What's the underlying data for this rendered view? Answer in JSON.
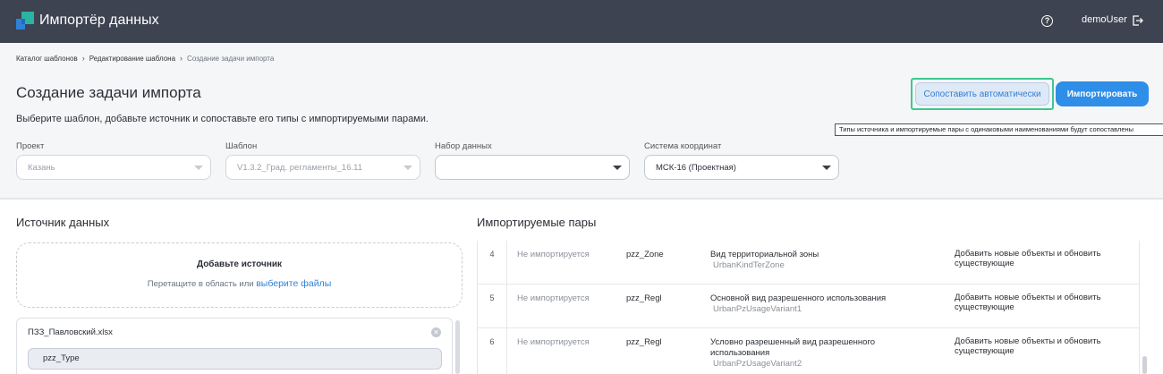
{
  "header": {
    "app_title": "Импортёр данных",
    "username": "demoUser",
    "help_icon_text": "?"
  },
  "breadcrumb": {
    "items": [
      "Каталог шаблонов",
      "Редактирование шаблона",
      "Создание задачи импорта"
    ],
    "separator": "›"
  },
  "page": {
    "title": "Создание задачи импорта",
    "subtitle": "Выберите шаблон, добавьте источник и сопоставьте его типы с импортируемыми парами."
  },
  "actions": {
    "auto_match_label": "Сопоставить автоматически",
    "import_label": "Импортировать",
    "tooltip": "Типы источника и импортируемые пары с одинаковыми наименованиями будут сопоставлены"
  },
  "fields": {
    "project": {
      "label": "Проект",
      "value": "Казань"
    },
    "template": {
      "label": "Шаблон",
      "value": "V1.3.2_Град. регламенты_16.11"
    },
    "dataset": {
      "label": "Набор данных",
      "value": ""
    },
    "crs": {
      "label": "Система координат",
      "value": "МСК-16 (Проектная)"
    }
  },
  "source": {
    "title": "Источник данных",
    "dropzone_title": "Добавьте источник",
    "dropzone_hint": "Перетащите в область или",
    "dropzone_link": "выберите файлы",
    "file_name": "ПЗЗ_Павловский.xlsx",
    "type_chip": "pzz_Type",
    "close_icon_text": "✕"
  },
  "pairs": {
    "title": "Импортируемые пары",
    "rows": [
      {
        "num": "4",
        "status": "Не импортируется",
        "code": "pzz_Zone",
        "name": "Вид территориальной зоны",
        "sub": "UrbanKindTerZone",
        "action": "Добавить новые объекты и обновить существующие"
      },
      {
        "num": "5",
        "status": "Не импортируется",
        "code": "pzz_Regl",
        "name": "Основной вид разрешенного использования",
        "sub": "UrbanPzUsageVariant1",
        "action": "Добавить новые объекты и обновить существующие"
      },
      {
        "num": "6",
        "status": "Не импортируется",
        "code": "pzz_Regl",
        "name": "Условно разрешенный вид разрешенного использования",
        "sub": "UrbanPzUsageVariant2",
        "action": "Добавить новые объекты и обновить существующие"
      }
    ]
  },
  "colors": {
    "topbar": "#3d4350",
    "accent": "#2f8ee8",
    "highlight": "#3cc88f",
    "logo_teal": "#2bb3a3",
    "logo_blue": "#2f80d6"
  }
}
